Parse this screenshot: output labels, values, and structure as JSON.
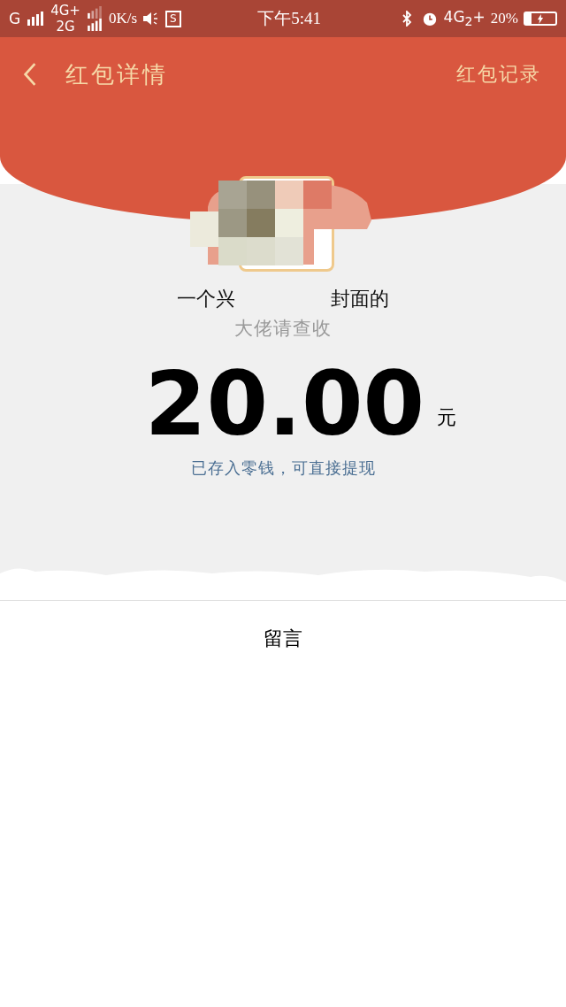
{
  "status_bar": {
    "sim1_type": "G",
    "sim2_top": "4G+",
    "sim2_bottom": "2G",
    "speed": "0K/s",
    "app_badge": "S",
    "time": "下午5:41",
    "network": "4G$_{2}$+",
    "battery_text": "20%",
    "charging": true
  },
  "header": {
    "title": "红包详情",
    "action": "红包记录"
  },
  "sender": {
    "title_parts": [
      "一个兴",
      "封面的"
    ],
    "subtitle": "大佬请查收"
  },
  "amount": {
    "value": "20.00",
    "unit": "元",
    "note": "已存入零钱，可直接提现"
  },
  "message": {
    "label": "留言"
  }
}
